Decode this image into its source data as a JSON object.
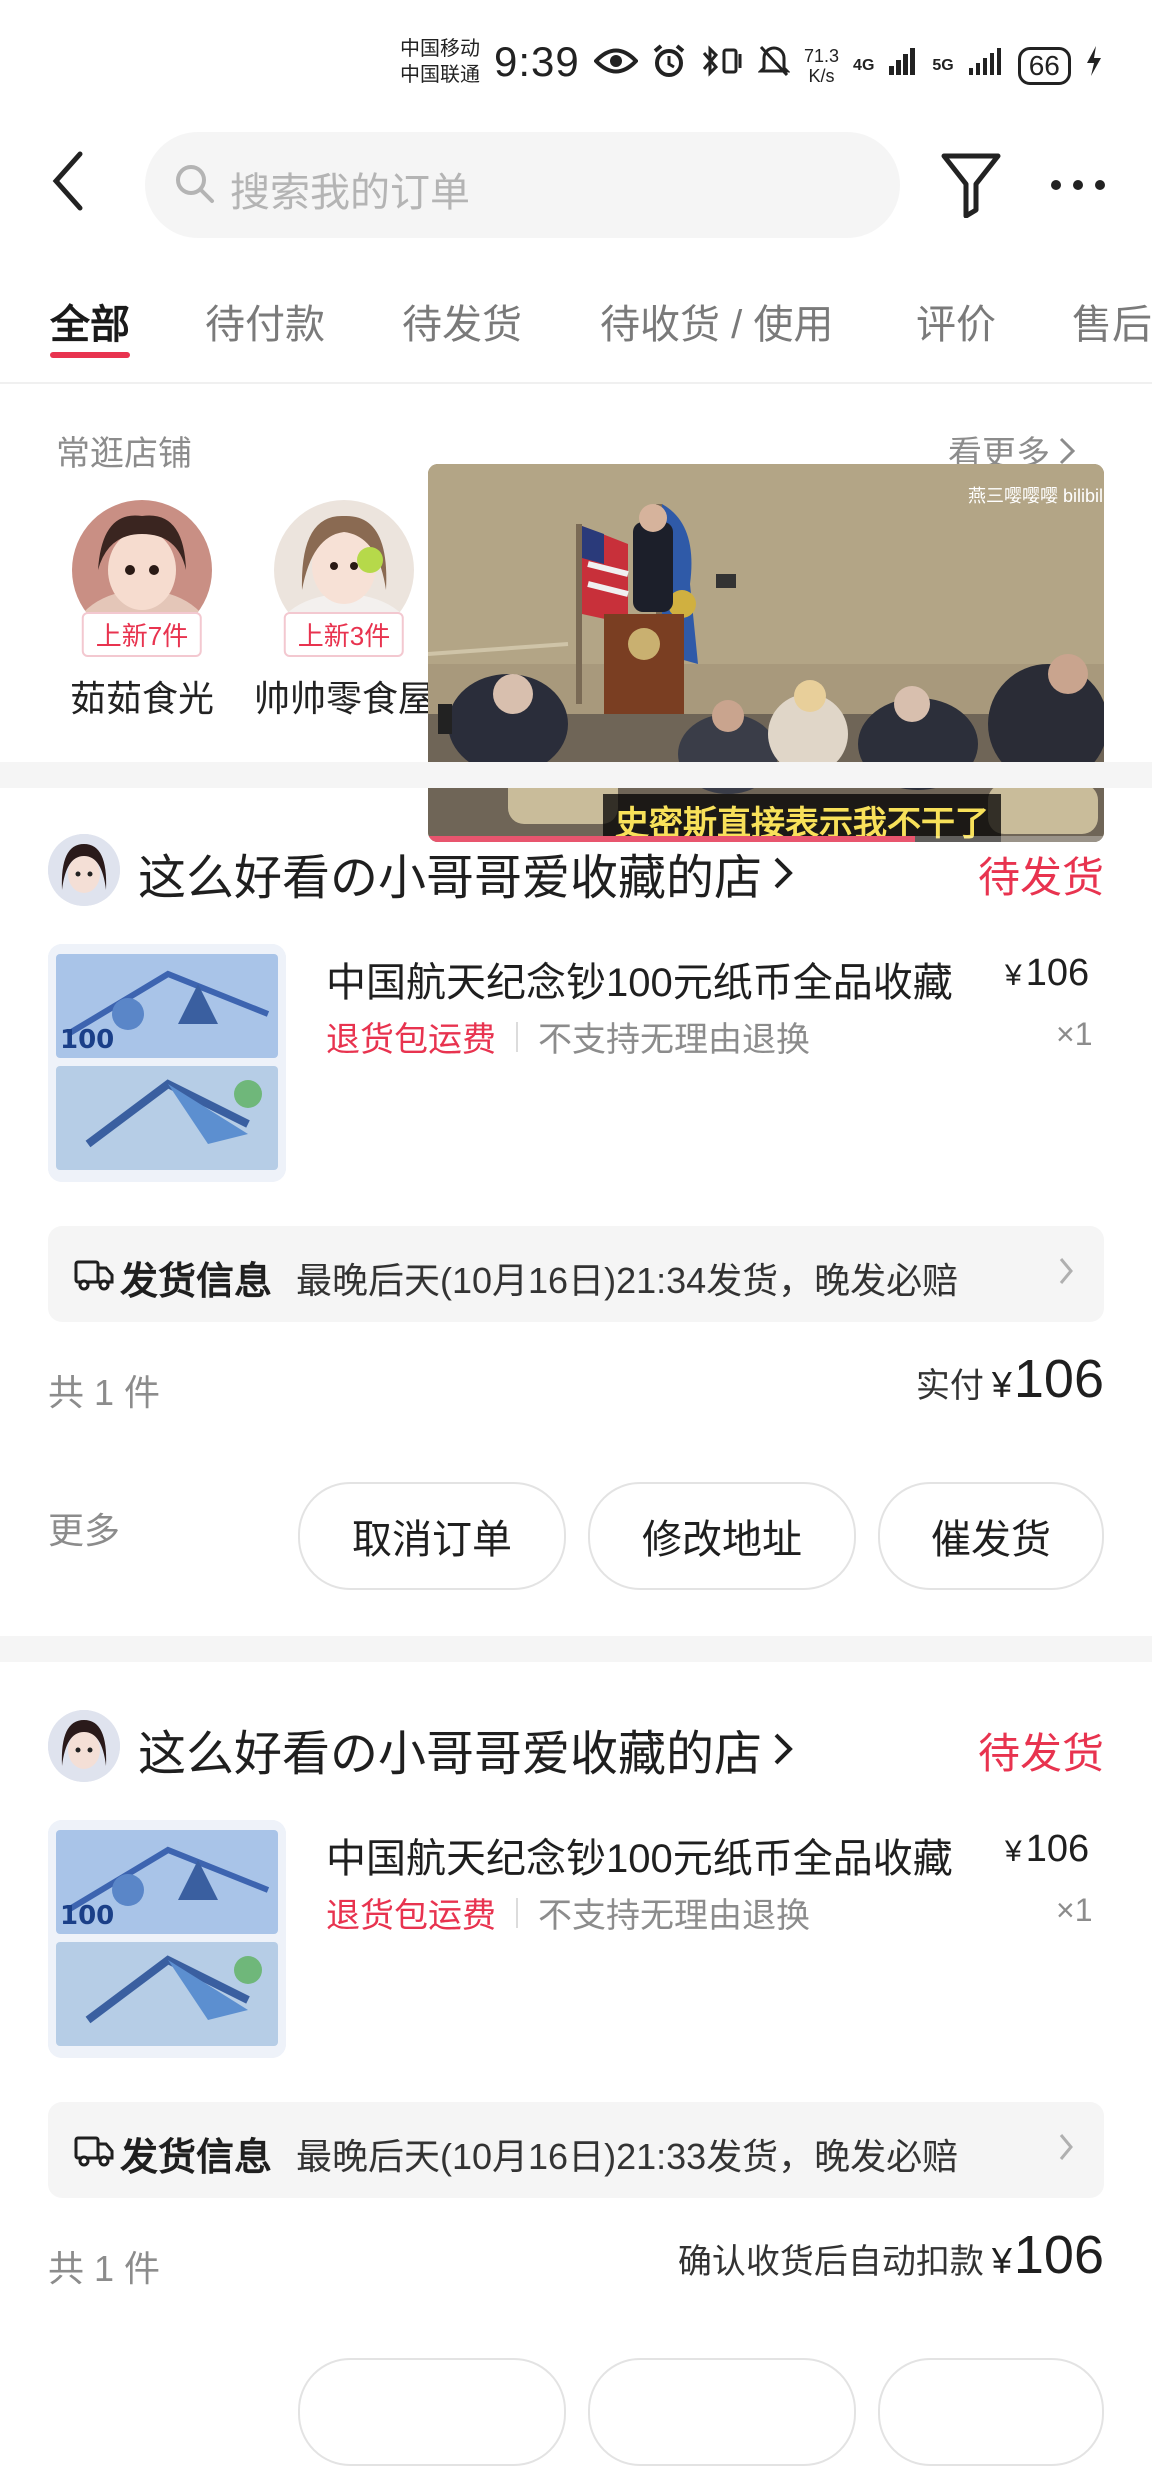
{
  "status_bar": {
    "carrier_1": "中国移动",
    "carrier_2": "中国联通",
    "time": "9:39",
    "speed_value": "71.3",
    "speed_unit": "K/s",
    "net_1": "4G",
    "net_2": "5G",
    "battery": "66"
  },
  "search": {
    "placeholder": "搜索我的订单"
  },
  "tabs": [
    {
      "label": "全部"
    },
    {
      "label": "待付款"
    },
    {
      "label": "待发货"
    },
    {
      "label": "待收货 / 使用"
    },
    {
      "label": "评价"
    },
    {
      "label": "售后"
    }
  ],
  "frequent_shops": {
    "title": "常逛店铺",
    "see_more": "看更多",
    "shops": [
      {
        "name": "茹茹食光",
        "badge": "上新7件"
      },
      {
        "name": "帅帅零食屋",
        "badge": "上新3件"
      }
    ]
  },
  "video": {
    "subtitle": "史密斯直接表示我不干了",
    "watermark": "燕三嘤嘤嘤  bilibili",
    "progress": 0.72
  },
  "orders": [
    {
      "shop_name": "这么好看の小哥哥爱收藏的店",
      "status": "待发货",
      "product_title": "中国航天纪念钞100元纸币全品收藏",
      "price_currency": "¥",
      "price": "106",
      "tag_red": "退货包运费",
      "tag_gray": "不支持无理由退换",
      "qty": "×1",
      "ship_label": "发货信息",
      "ship_text": "最晚后天(10月16日)21:34发货，晚发必赔",
      "count": "共 1 件",
      "paid_label": "实付",
      "paid_currency": "¥",
      "paid_amount": "106",
      "more": "更多",
      "buttons": [
        "取消订单",
        "修改地址",
        "催发货"
      ]
    },
    {
      "shop_name": "这么好看の小哥哥爱收藏的店",
      "status": "待发货",
      "product_title": "中国航天纪念钞100元纸币全品收藏",
      "price_currency": "¥",
      "price": "106",
      "tag_red": "退货包运费",
      "tag_gray": "不支持无理由退换",
      "qty": "×1",
      "ship_label": "发货信息",
      "ship_text": "最晚后天(10月16日)21:33发货，晚发必赔",
      "count": "共 1 件",
      "paid_label": "确认收货后自动扣款",
      "paid_currency": "¥",
      "paid_amount": "106"
    }
  ],
  "colors": {
    "accent": "#e8334f",
    "text": "#1f1f1f",
    "muted": "#8c8c8c",
    "panel": "#f5f5f5"
  }
}
